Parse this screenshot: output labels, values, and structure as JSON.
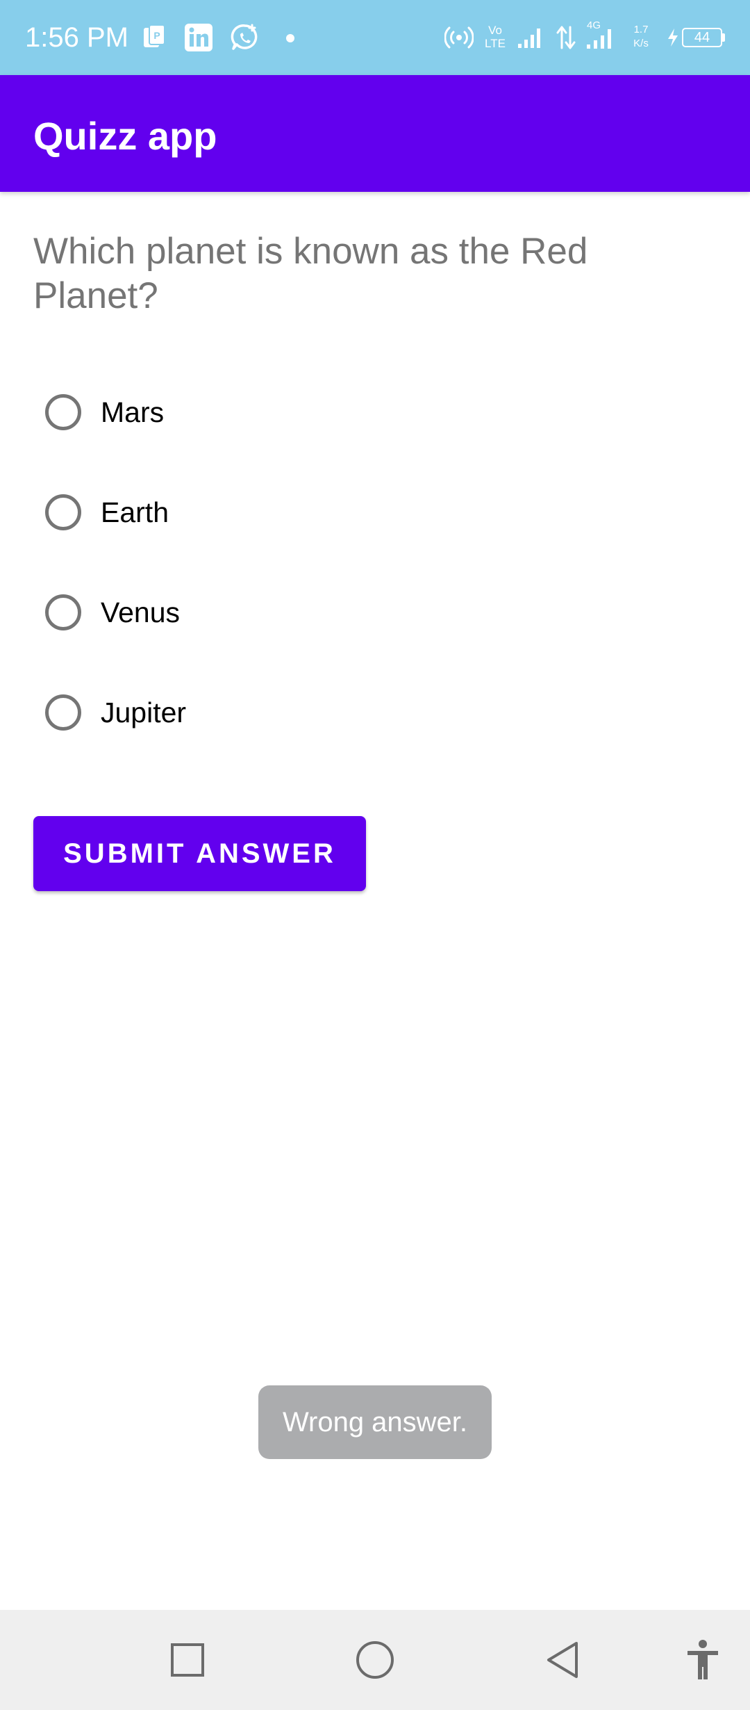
{
  "status_bar": {
    "time": "1:56 PM",
    "network_type": "4G",
    "volte_label": "Vo LTE",
    "speed_value": "1.7",
    "speed_unit": "K/s",
    "battery_level": "44",
    "icons": [
      "pdf-icon",
      "linkedin-icon",
      "whatsapp-icon",
      "notification-dot-icon",
      "hotspot-icon",
      "volte-icon",
      "signal-icon",
      "data-arrows-icon",
      "signal-4g-icon",
      "network-speed-icon",
      "charging-icon",
      "battery-icon"
    ],
    "background_color": "#87ceeb"
  },
  "app_bar": {
    "title": "Quizz app",
    "color": "#6200ee"
  },
  "quiz": {
    "question": "Which planet is known as the Red Planet?",
    "options": [
      {
        "label": "Mars",
        "selected": false
      },
      {
        "label": "Earth",
        "selected": false
      },
      {
        "label": "Venus",
        "selected": false
      },
      {
        "label": "Jupiter",
        "selected": false
      }
    ],
    "submit_label": "SUBMIT ANSWER"
  },
  "toast": {
    "message": "Wrong answer."
  },
  "nav_bar": {
    "buttons": [
      "recents-icon",
      "home-icon",
      "back-icon",
      "accessibility-icon"
    ]
  }
}
